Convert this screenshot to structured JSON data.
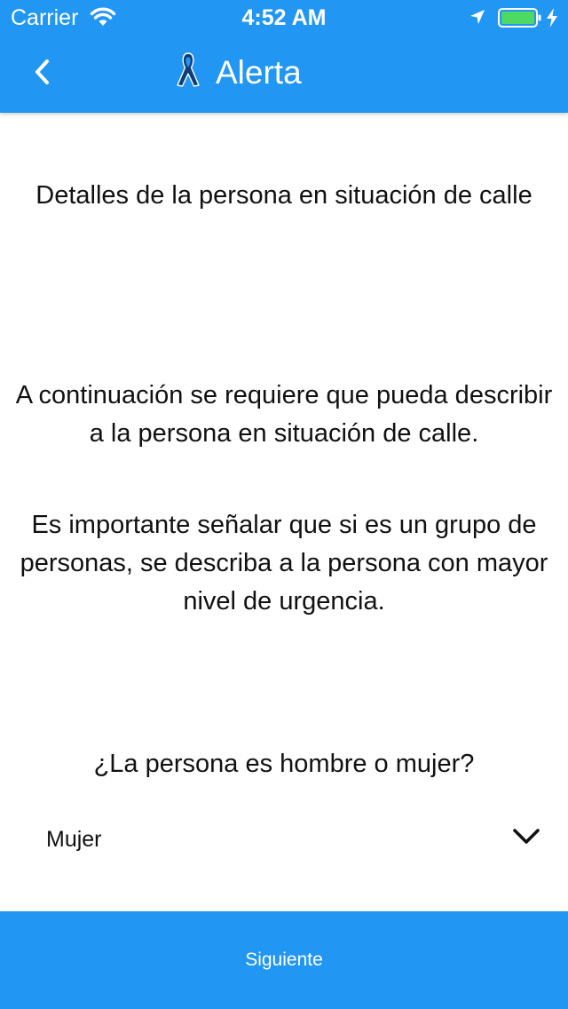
{
  "status_bar": {
    "carrier": "Carrier",
    "time": "4:52 AM",
    "icons": [
      "wifi-icon",
      "location-icon",
      "battery-icon",
      "charging-icon"
    ],
    "battery_color": "#4cd964"
  },
  "app_bar": {
    "title": "Alerta",
    "back_icon": "back-chevron-icon",
    "logo_icon": "awareness-ribbon-icon",
    "background_color": "#2196f3"
  },
  "main": {
    "heading": "Detalles de la persona en situación de calle",
    "intro": "A continuación se requiere que pueda describir a la persona en situación de calle.",
    "note": "Es importante señalar que si es un grupo de personas, se describa a la persona con mayor nivel de urgencia.",
    "question": "¿La persona es hombre o mujer?",
    "gender_select": {
      "selected": "Mujer",
      "icon": "chevron-down-icon"
    }
  },
  "footer": {
    "next_label": "Siguiente",
    "background_color": "#2196f3"
  }
}
